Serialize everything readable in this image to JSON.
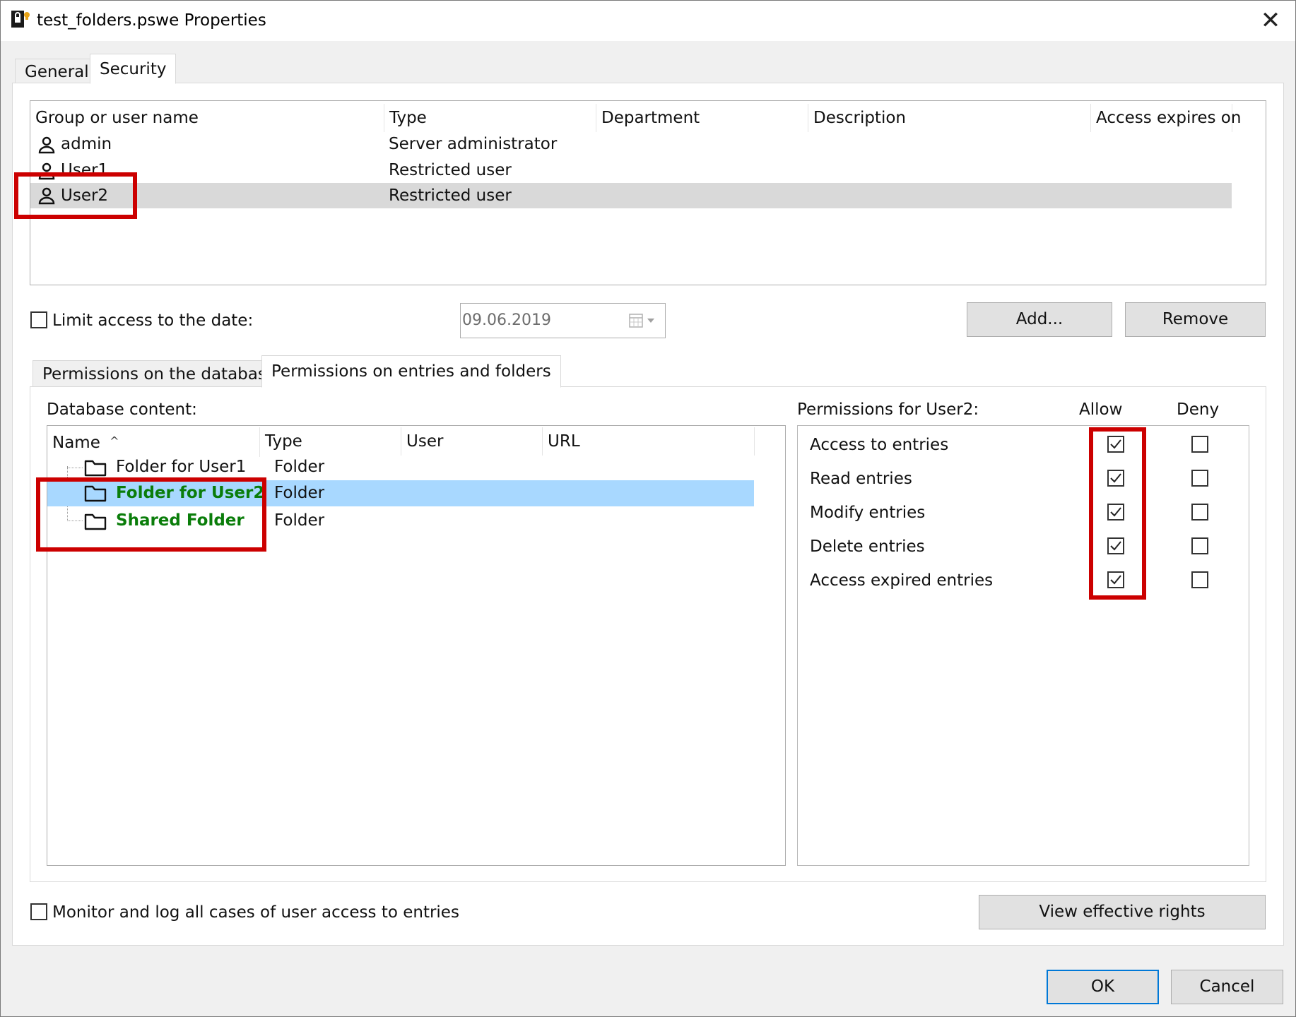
{
  "window": {
    "title": "test_folders.pswe Properties",
    "close_glyph": "✕"
  },
  "main_tabs": [
    {
      "label": "General",
      "active": false
    },
    {
      "label": "Security",
      "active": true
    }
  ],
  "users_table": {
    "columns": [
      "Group or user name",
      "Type",
      "Department",
      "Description",
      "Access expires on"
    ],
    "rows": [
      {
        "name": "admin",
        "type": "Server administrator",
        "selected": false
      },
      {
        "name": "User1",
        "type": "Restricted user",
        "selected": false
      },
      {
        "name": "User2",
        "type": "Restricted user",
        "selected": true
      }
    ]
  },
  "limit_access": {
    "label": "Limit access to the date:",
    "checked": false,
    "date_value": "09.06.2019"
  },
  "buttons": {
    "add": "Add...",
    "remove": "Remove",
    "view_rights": "View effective rights",
    "ok": "OK",
    "cancel": "Cancel"
  },
  "sub_tabs": [
    {
      "label": "Permissions on the database",
      "active": false
    },
    {
      "label": "Permissions on entries and folders",
      "active": true
    }
  ],
  "database_content": {
    "label": "Database content:",
    "columns": [
      "Name",
      "Type",
      "User",
      "URL"
    ],
    "sort_glyph": "^",
    "rows": [
      {
        "name": "Folder for User1",
        "type": "Folder",
        "highlight": false,
        "selected": false
      },
      {
        "name": "Folder for User2",
        "type": "Folder",
        "highlight": true,
        "selected": true
      },
      {
        "name": "Shared Folder",
        "type": "Folder",
        "highlight": true,
        "selected": false
      }
    ]
  },
  "permissions": {
    "label": "Permissions for User2:",
    "allow_label": "Allow",
    "deny_label": "Deny",
    "items": [
      {
        "label": "Access to entries",
        "allow": true,
        "deny": false
      },
      {
        "label": "Read entries",
        "allow": true,
        "deny": false
      },
      {
        "label": "Modify entries",
        "allow": true,
        "deny": false
      },
      {
        "label": "Delete entries",
        "allow": true,
        "deny": false
      },
      {
        "label": "Access expired entries",
        "allow": true,
        "deny": false
      }
    ]
  },
  "monitor": {
    "label": "Monitor and log all cases of user access to entries",
    "checked": false
  },
  "colors": {
    "highlight_annotation": "#cc0000",
    "green_text": "#0a7d0a",
    "selection_blue": "#a8d8ff",
    "selection_gray": "#d9d9d9",
    "default_button_border": "#0078d7"
  }
}
